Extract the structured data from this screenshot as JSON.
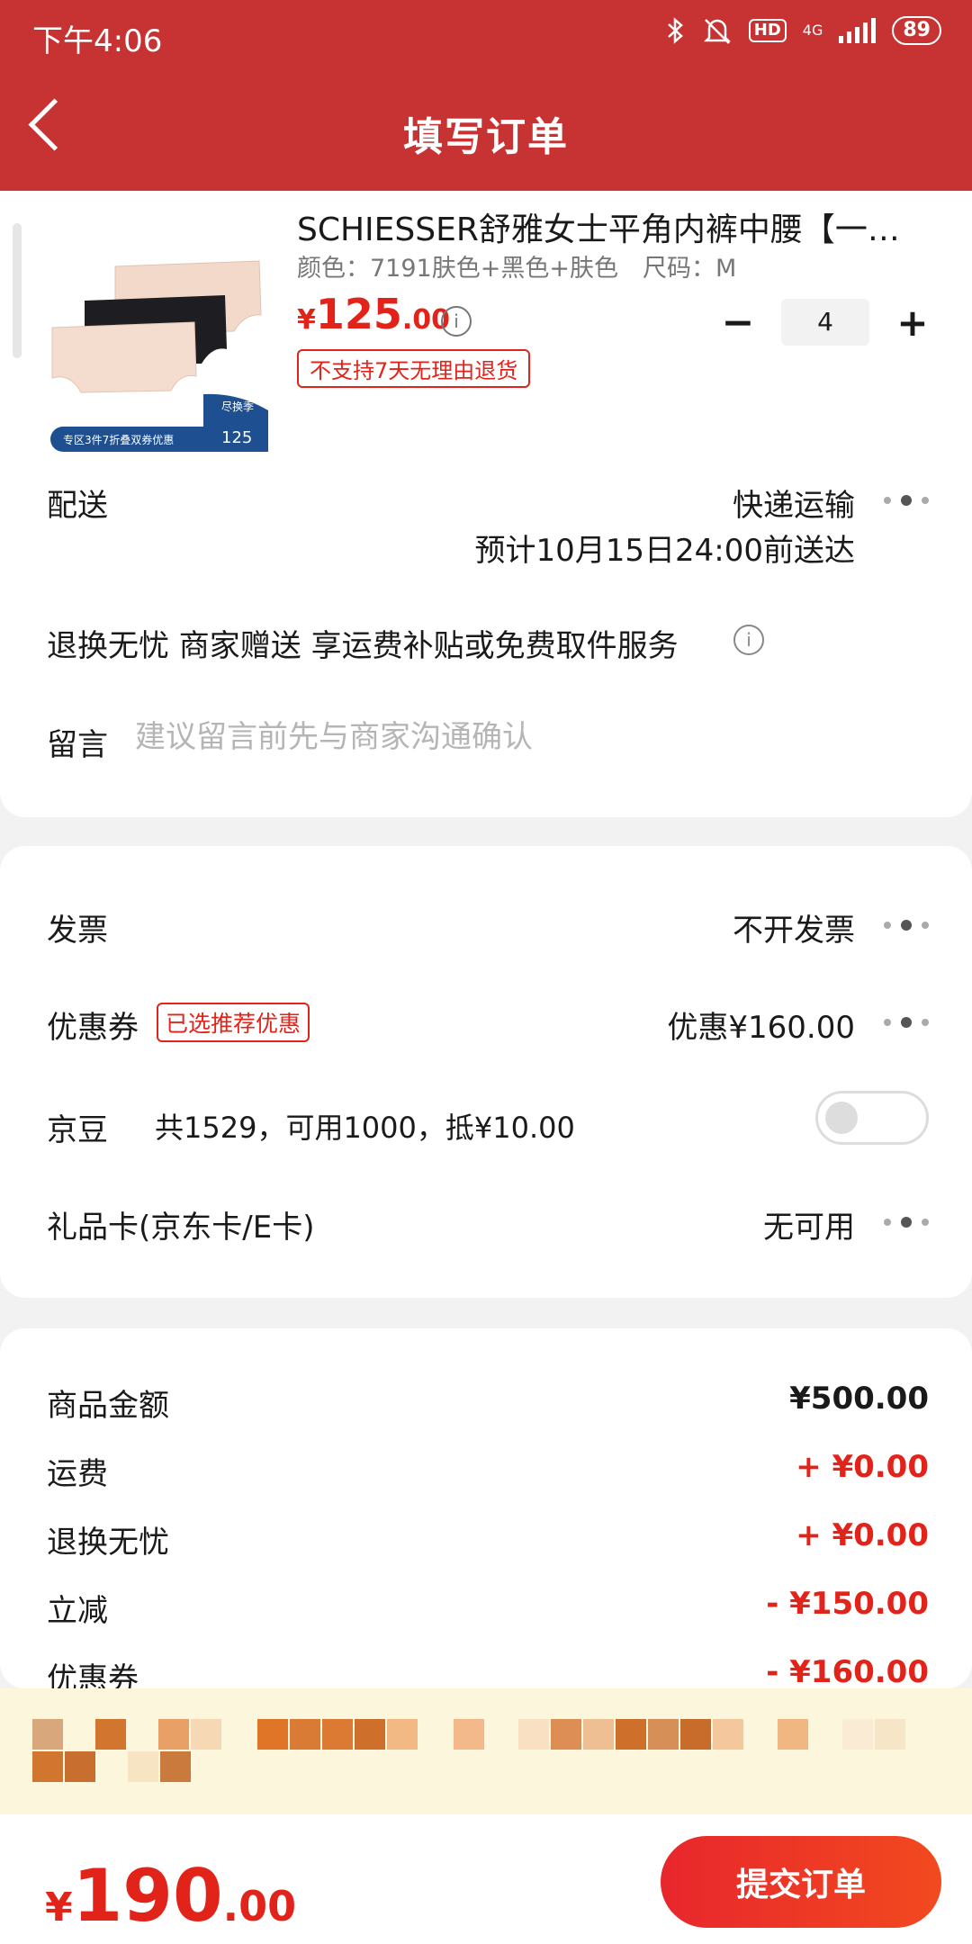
{
  "status_bar": {
    "time": "下午4:06",
    "network": "4G",
    "hd": "HD",
    "battery": "89"
  },
  "header": {
    "title": "填写订单"
  },
  "product": {
    "name": "SCHIESSER舒雅女士平角内裤中腰【一片式无痕】",
    "spec": "颜色：7191肤色+黑色+肤色　尺码：M",
    "price_currency": "¥",
    "price_int": "125",
    "price_dec": ".00",
    "tag": "不支持7天无理由退货",
    "quantity": "4",
    "minus": "−",
    "plus": "+",
    "thumb_badge_top": "尽换季",
    "thumb_badge_price": "125",
    "thumb_banner": "专区3件7折叠双券优惠"
  },
  "delivery": {
    "label": "配送",
    "method": "快递运输",
    "eta": "预计10月15日24:00前送达"
  },
  "service": {
    "text": "退换无忧 商家赠送  享运费补贴或免费取件服务"
  },
  "message": {
    "label": "留言",
    "placeholder": "建议留言前先与商家沟通确认"
  },
  "options": {
    "invoice": {
      "label": "发票",
      "value": "不开发票"
    },
    "coupon": {
      "label": "优惠券",
      "tag": "已选推荐优惠",
      "value": "优惠¥160.00"
    },
    "beans": {
      "label": "京豆",
      "text": "共1529，可用1000，抵¥10.00",
      "enabled": false
    },
    "giftcard": {
      "label": "礼品卡(京东卡/E卡)",
      "value": "无可用"
    }
  },
  "summary": [
    {
      "label": "商品金额",
      "value": "¥500.00",
      "type": "normal"
    },
    {
      "label": "运费",
      "value": "+ ¥0.00",
      "type": "red"
    },
    {
      "label": "退换无忧",
      "value": "+ ¥0.00",
      "type": "red"
    },
    {
      "label": "立减",
      "value": "- ¥150.00",
      "type": "red"
    },
    {
      "label": "优惠券",
      "value": "- ¥160.00",
      "type": "red"
    }
  ],
  "bottom": {
    "currency": "¥",
    "total_int": "190",
    "total_dec": ".00",
    "submit_label": "提交订单"
  },
  "colors": {
    "header": "#c73333",
    "accent": "#e2231a"
  }
}
